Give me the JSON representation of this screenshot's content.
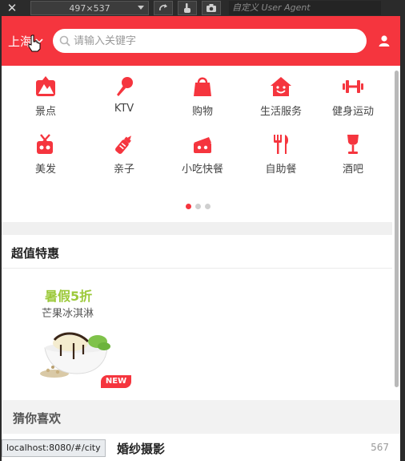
{
  "devtools": {
    "dimensions": "497×537",
    "user_agent_placeholder": "自定义 User Agent"
  },
  "header": {
    "city": "上海",
    "search_placeholder": "请输入关键字",
    "accent_color": "#f5353e"
  },
  "categories": [
    {
      "label": "景点",
      "icon": "mountain-icon"
    },
    {
      "label": "KTV",
      "icon": "microphone-icon"
    },
    {
      "label": "购物",
      "icon": "shopping-bag-icon"
    },
    {
      "label": "生活服务",
      "icon": "house-smile-icon"
    },
    {
      "label": "健身运动",
      "icon": "dumbbell-icon"
    },
    {
      "label": "美发",
      "icon": "scissors-icon"
    },
    {
      "label": "亲子",
      "icon": "baby-bottle-icon"
    },
    {
      "label": "小吃快餐",
      "icon": "food-box-icon"
    },
    {
      "label": "自助餐",
      "icon": "fork-knife-icon"
    },
    {
      "label": "酒吧",
      "icon": "wine-glass-icon"
    }
  ],
  "pager": {
    "total": 3,
    "active": 1
  },
  "deals": {
    "title": "超值特惠",
    "card": {
      "promo": "暑假5折",
      "product": "芒果冰淇淋",
      "badge": "NEW"
    }
  },
  "guess": {
    "title": "猜你喜欢"
  },
  "listing": {
    "title": "婚纱摄影",
    "count": "567"
  },
  "status_url": "localhost:8080/#/city"
}
